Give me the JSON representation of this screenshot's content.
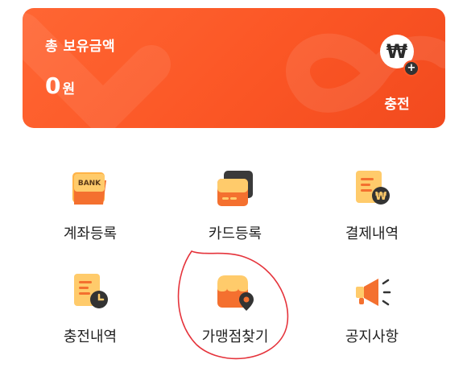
{
  "balance": {
    "label": "총 보유금액",
    "amount": "0",
    "unit": "원"
  },
  "charge": {
    "symbol": "₩",
    "plus": "+",
    "label": "충전"
  },
  "menu": [
    {
      "label": "계좌등록",
      "icon": "bank-card-icon",
      "icon_text": "BANK"
    },
    {
      "label": "카드등록",
      "icon": "credit-card-icon"
    },
    {
      "label": "결제내역",
      "icon": "payment-receipt-icon",
      "icon_text": "₩"
    },
    {
      "label": "충전내역",
      "icon": "charge-history-icon"
    },
    {
      "label": "가맹점찾기",
      "icon": "store-location-icon"
    },
    {
      "label": "공지사항",
      "icon": "megaphone-icon"
    }
  ],
  "colors": {
    "brand": "#fb5625",
    "icon_orange": "#f4702f",
    "icon_yellow": "#ffcb6b",
    "annotation": "#e5333b"
  }
}
